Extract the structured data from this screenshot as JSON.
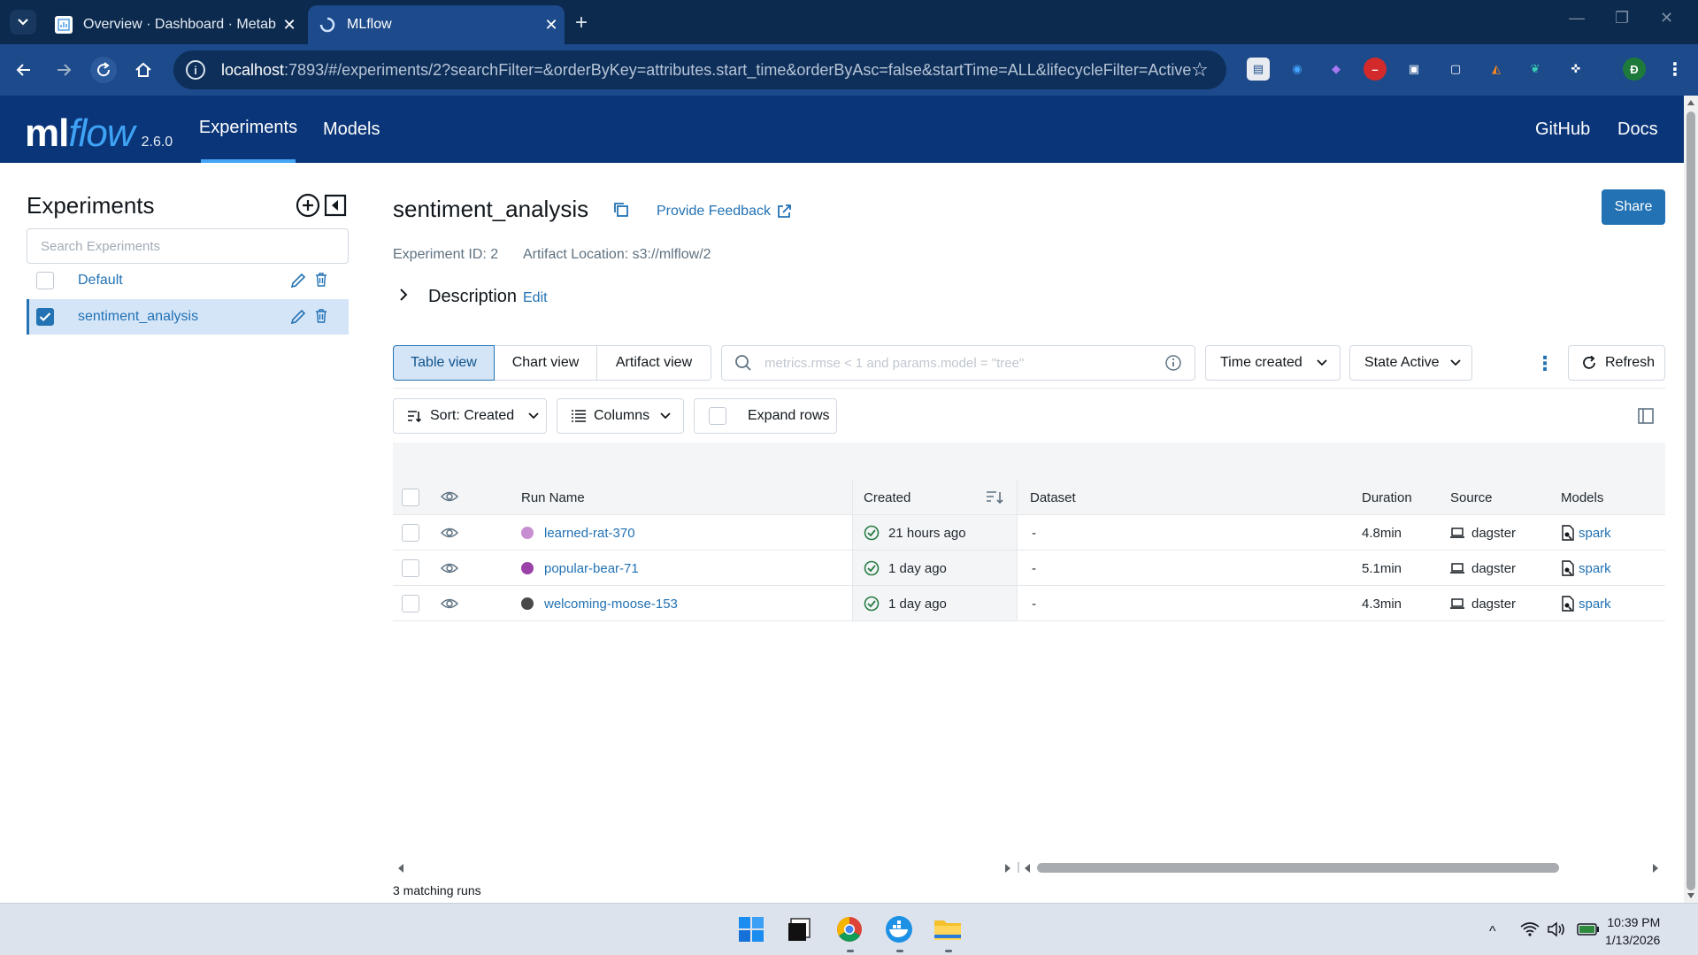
{
  "browser": {
    "tabs": [
      {
        "title": "Overview · Dashboard · Metaba",
        "active": false
      },
      {
        "title": "MLflow",
        "active": true
      }
    ],
    "url_host": "localhost",
    "url_rest": ":7893/#/experiments/2?searchFilter=&orderByKey=attributes.start_time&orderByAsc=false&startTime=ALL&lifecycleFilter=Active...",
    "profile_initial": "Đ"
  },
  "header": {
    "logo_ml": "ml",
    "logo_flow": "flow",
    "version": "2.6.0",
    "nav": [
      "Experiments",
      "Models"
    ],
    "right_links": [
      "GitHub",
      "Docs"
    ]
  },
  "sidebar": {
    "title": "Experiments",
    "search_placeholder": "Search Experiments",
    "experiments": [
      {
        "name": "Default",
        "checked": false
      },
      {
        "name": "sentiment_analysis",
        "checked": true
      }
    ]
  },
  "experiment": {
    "name": "sentiment_analysis",
    "feedback_link": "Provide Feedback",
    "share_label": "Share",
    "id_label": "Experiment ID: 2",
    "artifact_label": "Artifact Location: s3://mlflow/2",
    "description_label": "Description",
    "edit_label": "Edit"
  },
  "controls": {
    "views": [
      "Table view",
      "Chart view",
      "Artifact view"
    ],
    "search_placeholder": "metrics.rmse < 1 and params.model = \"tree\"",
    "time_filter": "Time created",
    "state_filter": "State Active",
    "refresh": "Refresh",
    "sort": "Sort: Created",
    "columns": "Columns",
    "expand_rows": "Expand rows"
  },
  "table": {
    "headers": {
      "run_name": "Run Name",
      "created": "Created",
      "dataset": "Dataset",
      "duration": "Duration",
      "source": "Source",
      "models": "Models"
    },
    "rows": [
      {
        "run_name": "learned-rat-370",
        "color": "#c78fd1",
        "created": "21 hours ago",
        "dataset": "-",
        "duration": "4.8min",
        "source": "dagster",
        "model": "spark"
      },
      {
        "run_name": "popular-bear-71",
        "color": "#9b42a8",
        "created": "1 day ago",
        "dataset": "-",
        "duration": "5.1min",
        "source": "dagster",
        "model": "spark"
      },
      {
        "run_name": "welcoming-moose-153",
        "color": "#4a4a4a",
        "created": "1 day ago",
        "dataset": "-",
        "duration": "4.3min",
        "source": "dagster",
        "model": "spark"
      }
    ],
    "matching": "3 matching runs"
  },
  "taskbar": {
    "time": "10:39 PM",
    "date": "1/13/2026"
  }
}
